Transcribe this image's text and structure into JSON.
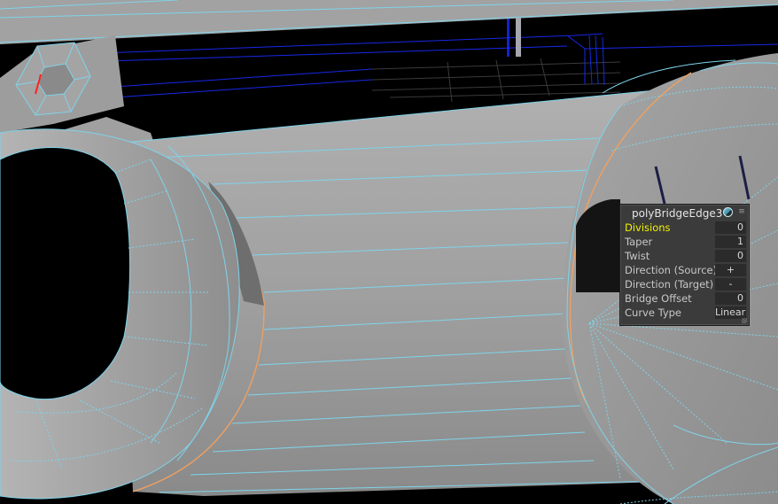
{
  "inbox": {
    "title": "polyBridgeEdge3",
    "icons": {
      "node": "node-state-icon",
      "menu": "menu-icon"
    },
    "rows": [
      {
        "label": "Divisions",
        "value": "0",
        "active": true
      },
      {
        "label": "Taper",
        "value": "1"
      },
      {
        "label": "Twist",
        "value": "0"
      },
      {
        "label": "Direction (Source)",
        "value": "+"
      },
      {
        "label": "Direction (Target)",
        "value": "-"
      },
      {
        "label": "Bridge Offset",
        "value": "0"
      },
      {
        "label": "Curve Type",
        "value": "Linear"
      }
    ]
  },
  "colors": {
    "background": "#000000",
    "mesh_fill": "#9a9a9a",
    "wireframe": "#7fd3ea",
    "selected_edge": "#f0a060",
    "grid": "#3a3a3a",
    "blue_wire": "#1a2cff",
    "active_attribute": "#f2f200"
  }
}
